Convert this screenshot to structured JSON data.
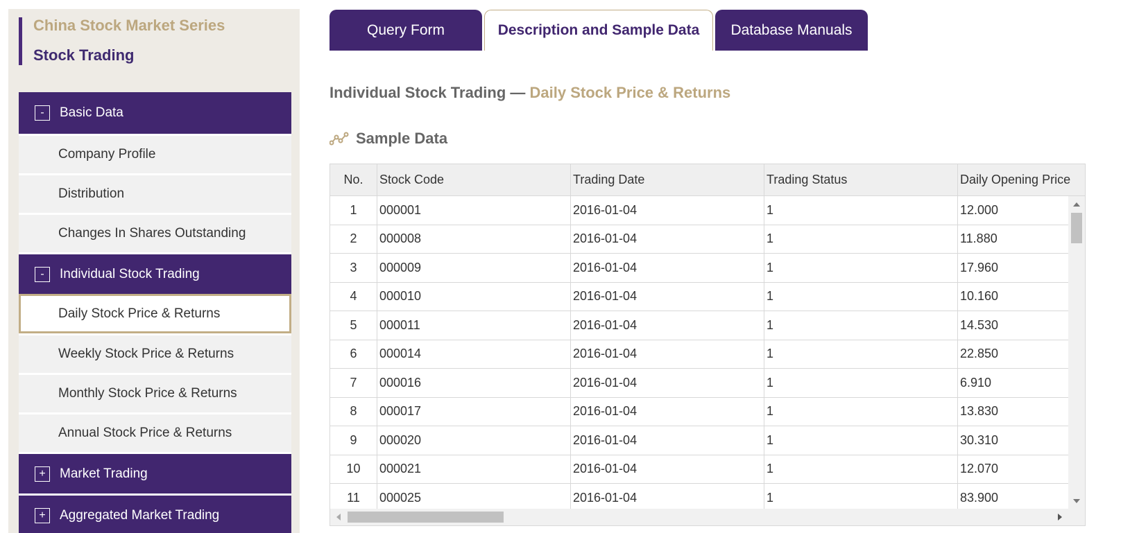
{
  "sidebar": {
    "series_title": "China Stock Market Series",
    "series_sub": "Stock Trading",
    "groups": [
      {
        "label": "Basic Data",
        "toggle": "-"
      },
      {
        "label": "Individual Stock Trading",
        "toggle": "-"
      },
      {
        "label": "Market Trading",
        "toggle": "+"
      },
      {
        "label": "Aggregated Market Trading",
        "toggle": "+"
      }
    ],
    "basic_items": [
      "Company Profile",
      "Distribution",
      "Changes In Shares Outstanding"
    ],
    "trading_items": [
      "Daily Stock Price & Returns",
      "Weekly Stock Price & Returns",
      "Monthly Stock Price & Returns",
      "Annual Stock Price & Returns"
    ]
  },
  "tabs": [
    "Query Form",
    "Description and Sample Data",
    "Database Manuals"
  ],
  "page_title": {
    "prefix": "Individual Stock Trading —",
    "accent": "Daily Stock Price & Returns"
  },
  "sample_heading": "Sample Data",
  "table": {
    "headers": [
      "No.",
      "Stock Code",
      "Trading Date",
      "Trading Status",
      "Daily Opening Price"
    ],
    "rows": [
      [
        "1",
        "000001",
        "2016-01-04",
        "1",
        "12.000"
      ],
      [
        "2",
        "000008",
        "2016-01-04",
        "1",
        "11.880"
      ],
      [
        "3",
        "000009",
        "2016-01-04",
        "1",
        "17.960"
      ],
      [
        "4",
        "000010",
        "2016-01-04",
        "1",
        "10.160"
      ],
      [
        "5",
        "000011",
        "2016-01-04",
        "1",
        "14.530"
      ],
      [
        "6",
        "000014",
        "2016-01-04",
        "1",
        "22.850"
      ],
      [
        "7",
        "000016",
        "2016-01-04",
        "1",
        "6.910"
      ],
      [
        "8",
        "000017",
        "2016-01-04",
        "1",
        "13.830"
      ],
      [
        "9",
        "000020",
        "2016-01-04",
        "1",
        "30.310"
      ],
      [
        "10",
        "000021",
        "2016-01-04",
        "1",
        "12.070"
      ],
      [
        "11",
        "000025",
        "2016-01-04",
        "1",
        "83.900"
      ]
    ]
  },
  "colors": {
    "purple": "#41266f",
    "gold": "#bca77f"
  },
  "icons": {
    "sample": "trend-line-icon"
  }
}
